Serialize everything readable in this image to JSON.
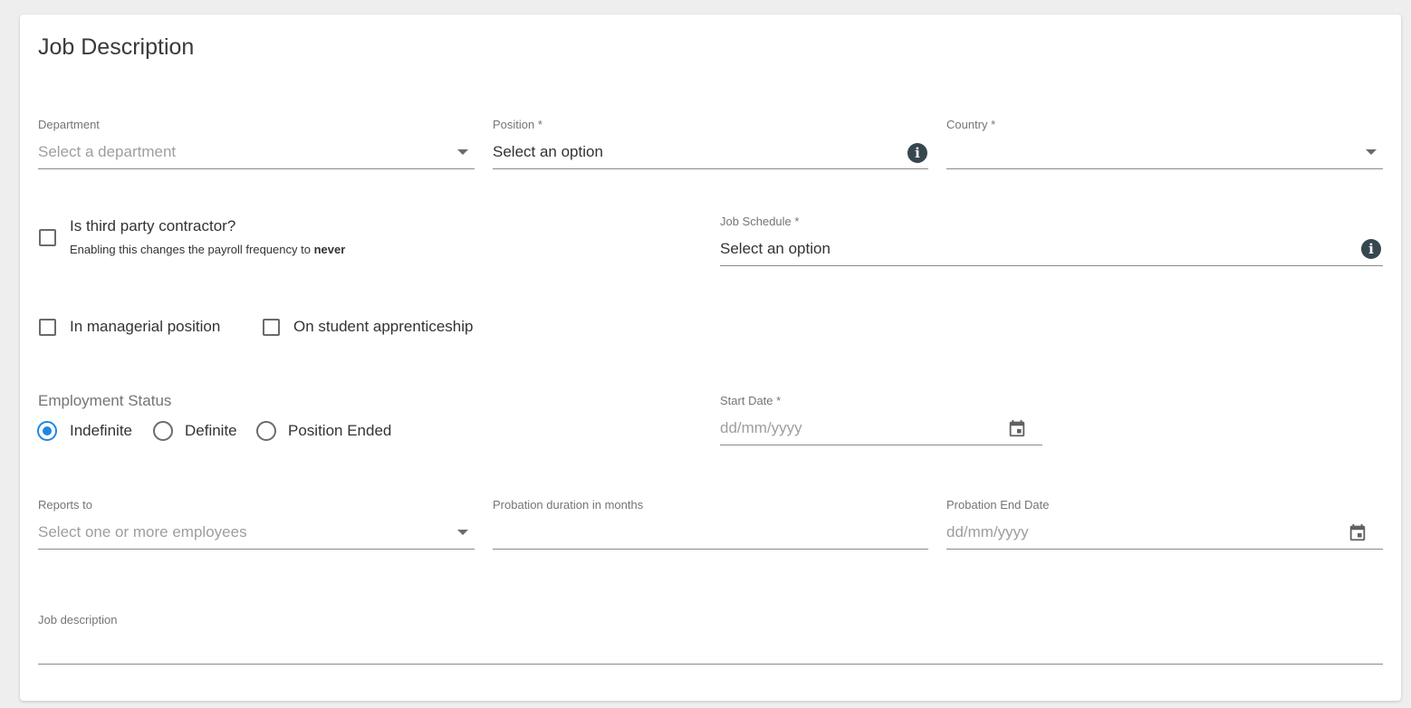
{
  "form": {
    "title": "Job Description",
    "department": {
      "label": "Department",
      "placeholder": "Select a department"
    },
    "position": {
      "label": "Position *",
      "value": "Select an option"
    },
    "country": {
      "label": "Country *",
      "value": ""
    },
    "third_party": {
      "label": "Is third party contractor?",
      "helper_prefix": "Enabling this changes the payroll frequency to ",
      "helper_bold": "never",
      "checked": false
    },
    "job_schedule": {
      "label": "Job Schedule *",
      "value": "Select an option"
    },
    "managerial": {
      "label": "In managerial position",
      "checked": false
    },
    "apprenticeship": {
      "label": "On student apprenticeship",
      "checked": false
    },
    "employment_status": {
      "label": "Employment Status",
      "options": [
        "Indefinite",
        "Definite",
        "Position Ended"
      ],
      "selected": "Indefinite"
    },
    "start_date": {
      "label": "Start Date *",
      "placeholder": "dd/mm/yyyy"
    },
    "reports_to": {
      "label": "Reports to",
      "placeholder": "Select one or more employees"
    },
    "probation_duration": {
      "label": "Probation duration in months",
      "value": ""
    },
    "probation_end": {
      "label": "Probation End Date",
      "placeholder": "dd/mm/yyyy"
    },
    "job_description": {
      "label": "Job description",
      "value": ""
    }
  },
  "colors": {
    "accent": "#1e88e5",
    "info_icon": "#37474f",
    "background": "#eeeeee"
  },
  "icons": {
    "dropdown": "caret-down-icon",
    "info": "info-icon",
    "date": "calendar-icon"
  }
}
